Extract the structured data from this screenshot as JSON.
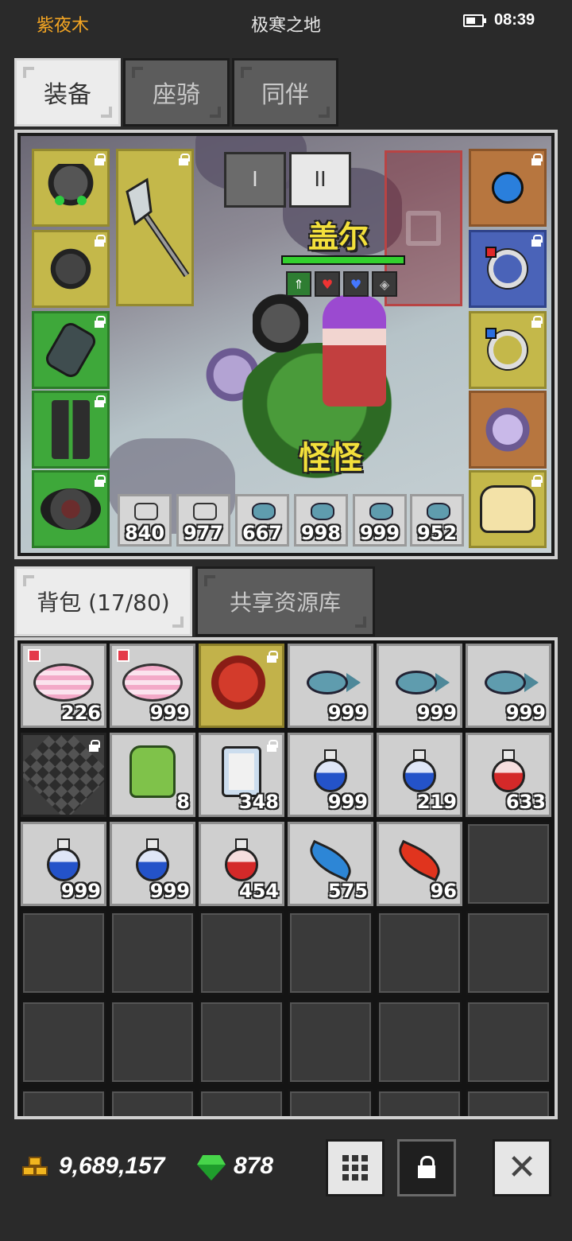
{
  "status": {
    "player_name": "紫夜木",
    "zone": "极寒之地",
    "time": "08:39",
    "battery_level": 0.6
  },
  "top_tabs": [
    {
      "label": "装备",
      "active": true
    },
    {
      "label": "座骑",
      "active": false
    },
    {
      "label": "同伴",
      "active": false
    }
  ],
  "battle_tabs": [
    {
      "label": "I",
      "active": false
    },
    {
      "label": "II",
      "active": true
    }
  ],
  "hero": {
    "name": "盖尔",
    "hp": 1.0
  },
  "pet": {
    "name": "怪怪"
  },
  "equip_left": [
    {
      "name": "helmet-icon",
      "locked": true
    },
    {
      "name": "shoulder-armor-icon",
      "locked": true
    },
    {
      "name": "gauntlet-icon",
      "locked": true
    },
    {
      "name": "boots-icon",
      "locked": true
    },
    {
      "name": "belt-icon",
      "locked": true
    }
  ],
  "equip_weapon": {
    "name": "axe-icon",
    "locked": true
  },
  "equip_right": [
    {
      "name": "amulet-icon",
      "locked": true
    },
    {
      "name": "ring-red-icon",
      "locked": true
    },
    {
      "name": "ring-blue-icon",
      "locked": true
    },
    {
      "name": "unicorn-mount-icon",
      "locked": false
    },
    {
      "name": "cat-pet-icon",
      "locked": true
    }
  ],
  "quickbar": [
    {
      "icon": "potion-icon",
      "qty": "840"
    },
    {
      "icon": "potion-icon",
      "qty": "977"
    },
    {
      "icon": "fish-icon",
      "qty": "667"
    },
    {
      "icon": "fish-icon",
      "qty": "998"
    },
    {
      "icon": "fish-icon",
      "qty": "999"
    },
    {
      "icon": "fish-icon",
      "qty": "952"
    }
  ],
  "bag_tabs": [
    {
      "label": "背包 (17/80)",
      "active": true
    },
    {
      "label": "共享资源库",
      "active": false
    }
  ],
  "bag_items": [
    {
      "icon": "cake-icon",
      "qty": "226",
      "flag": true
    },
    {
      "icon": "cake-icon",
      "qty": "999",
      "flag": true
    },
    {
      "icon": "dragon-icon",
      "qty": "",
      "locked": true,
      "selected": true
    },
    {
      "icon": "fish-icon",
      "qty": "999"
    },
    {
      "icon": "fish-icon",
      "qty": "999"
    },
    {
      "icon": "fish-icon",
      "qty": "999"
    },
    {
      "icon": "whip-icon",
      "qty": "",
      "locked": true,
      "dark": true
    },
    {
      "icon": "backpack-icon",
      "qty": "8"
    },
    {
      "icon": "scroll-icon",
      "qty": "348",
      "locked": true
    },
    {
      "icon": "blue-potion-icon",
      "qty": "999"
    },
    {
      "icon": "blue-potion-icon",
      "qty": "219"
    },
    {
      "icon": "red-potion-icon",
      "qty": "633"
    },
    {
      "icon": "blue-potion-icon",
      "qty": "999"
    },
    {
      "icon": "blue-potion-icon",
      "qty": "999"
    },
    {
      "icon": "red-potion-icon",
      "qty": "454"
    },
    {
      "icon": "blue-leaf-icon",
      "qty": "575"
    },
    {
      "icon": "red-leaf-icon",
      "qty": "96"
    }
  ],
  "currency": {
    "gold": "9,689,157",
    "gems": "878"
  },
  "colors": {
    "accent": "#f5a623",
    "hero_name": "#f3e03b",
    "slot_yellow": "#c4b84a",
    "slot_green": "#3ea83a",
    "slot_blue": "#4a63b8",
    "slot_orange": "#b7763f"
  }
}
